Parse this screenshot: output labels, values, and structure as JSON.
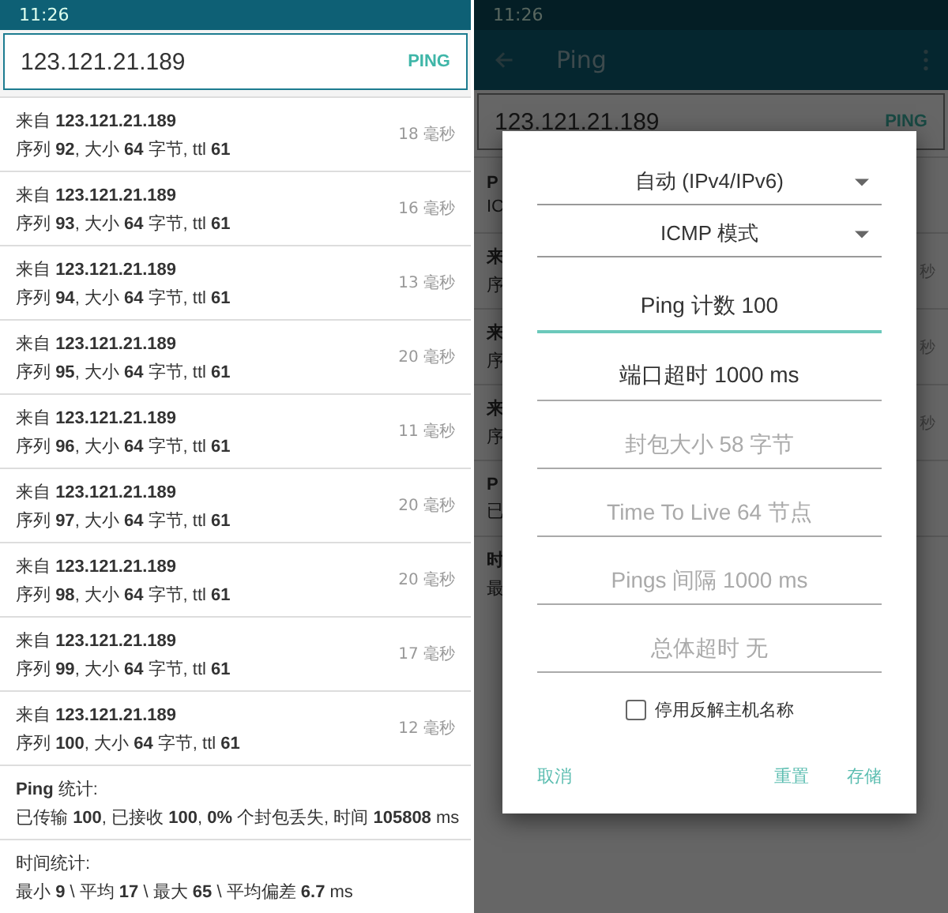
{
  "left": {
    "status_time": "11:26",
    "search": {
      "value": "123.121.21.189",
      "button": "PING"
    },
    "replies": [
      {
        "line1": "来自 **123.121.21.189**",
        "line2": "序列 **92**, 大小 **64** 字节, ttl **61**",
        "time": "18 毫秒"
      },
      {
        "line1": "来自 **123.121.21.189**",
        "line2": "序列 **93**, 大小 **64** 字节, ttl **61**",
        "time": "16 毫秒"
      },
      {
        "line1": "来自 **123.121.21.189**",
        "line2": "序列 **94**, 大小 **64** 字节, ttl **61**",
        "time": "13 毫秒"
      },
      {
        "line1": "来自 **123.121.21.189**",
        "line2": "序列 **95**, 大小 **64** 字节, ttl **61**",
        "time": "20 毫秒"
      },
      {
        "line1": "来自 **123.121.21.189**",
        "line2": "序列 **96**, 大小 **64** 字节, ttl **61**",
        "time": "11 毫秒"
      },
      {
        "line1": "来自 **123.121.21.189**",
        "line2": "序列 **97**, 大小 **64** 字节, ttl **61**",
        "time": "20 毫秒"
      },
      {
        "line1": "来自 **123.121.21.189**",
        "line2": "序列 **98**, 大小 **64** 字节, ttl **61**",
        "time": "20 毫秒"
      },
      {
        "line1": "来自 **123.121.21.189**",
        "line2": "序列 **99**, 大小 **64** 字节, ttl **61**",
        "time": "17 毫秒"
      },
      {
        "line1": "来自 **123.121.21.189**",
        "line2": "序列 **100**, 大小 **64** 字节, ttl **61**",
        "time": "12 毫秒"
      }
    ],
    "stats": [
      {
        "title": "**Ping** 统计:",
        "text": "已传输 **100**, 已接收 **100**, **0%** 个封包丢失, 时间 **105808** ms"
      },
      {
        "title": "时间统计:",
        "text": "最小 **9** \\ 平均 **17** \\ 最大 **65** \\ 平均偏差 **6.7** ms"
      }
    ]
  },
  "right": {
    "status_time": "11:26",
    "toolbar": {
      "title": "Ping"
    },
    "search": {
      "value": "123.121.21.189",
      "button": "PING"
    },
    "background_rows": [
      {
        "line1": "P",
        "line2": "IC"
      },
      {
        "line1": "来",
        "line2": "序",
        "time": "秒"
      },
      {
        "line1": "来",
        "line2": "序",
        "time": "秒"
      },
      {
        "line1": "来",
        "line2": "序",
        "time": "秒"
      },
      {
        "line1": "P",
        "line2": "已"
      },
      {
        "line1": "时",
        "line2": "最"
      }
    ],
    "dialog": {
      "selects": [
        {
          "value": "自动 (IPv4/IPv6)"
        },
        {
          "value": "ICMP 模式"
        }
      ],
      "fields": [
        {
          "value": "Ping 计数 100",
          "focused": true
        },
        {
          "value": "端口超时 1000 ms",
          "focused": false
        },
        {
          "placeholder": "封包大小 58 字节",
          "focused": false
        },
        {
          "placeholder": "Time To Live 64 节点",
          "focused": false
        },
        {
          "placeholder": "Pings 间隔 1000 ms",
          "focused": false
        },
        {
          "placeholder": "总体超时 无",
          "focused": false
        }
      ],
      "checkbox": {
        "label": "停用反解主机名称",
        "checked": false
      },
      "cancel": "取消",
      "actions": [
        "重置",
        "存储"
      ]
    }
  }
}
